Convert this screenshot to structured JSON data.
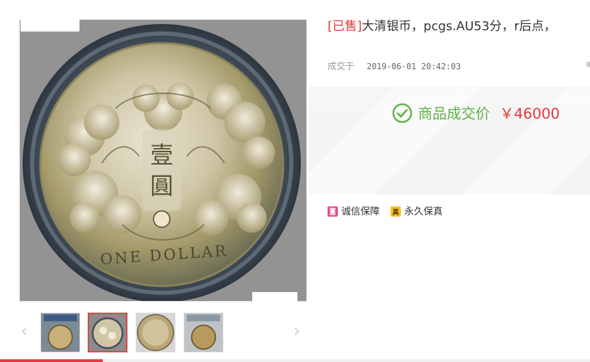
{
  "product": {
    "sold_tag": "[已售]",
    "title": "大清银币，pcgs.AU53分，r后点，",
    "deal_label": "成交于",
    "deal_time": "2019-06-01 20:42:03",
    "price_label": "商品成交价",
    "price_value": "￥46000"
  },
  "guarantees": [
    {
      "label": "诚信保障",
      "icon": "shield-icon",
      "color": "#e54d8a"
    },
    {
      "label": "永久保真",
      "icon": "genuine-icon",
      "color": "#f5c425"
    }
  ],
  "gallery": {
    "main_image": "coin-photo",
    "thumbnails": [
      "coin-slab-front",
      "coin-dragon-side",
      "coin-reverse-side",
      "coin-slab-back"
    ],
    "active_index": 1,
    "prev_arrow": "‹",
    "next_arrow": "›"
  },
  "colors": {
    "sold": "#e4393c",
    "price_label": "#5db346",
    "price_value": "#e4393c",
    "active_thumb_border": "#d8484a"
  }
}
